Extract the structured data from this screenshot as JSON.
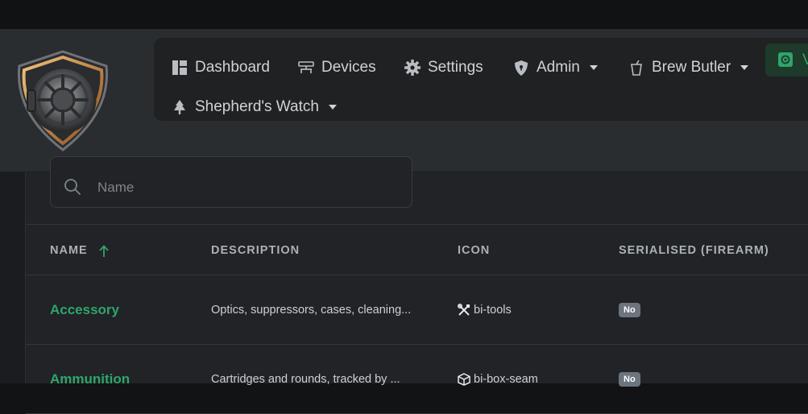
{
  "nav": {
    "items": [
      {
        "label": "Dashboard",
        "icon": "dashboard-icon"
      },
      {
        "label": "Devices",
        "icon": "devices-icon"
      },
      {
        "label": "Settings",
        "icon": "gear-icon"
      },
      {
        "label": "Admin",
        "icon": "shield-icon",
        "dropdown": true
      },
      {
        "label": "Brew Butler",
        "icon": "cup-icon",
        "dropdown": true
      },
      {
        "label": "Shepherd's Watch",
        "icon": "tree-icon",
        "dropdown": true
      }
    ],
    "active_label": "V",
    "active_color": "#1d3a2a",
    "accent_color": "#2fa56a"
  },
  "search": {
    "placeholder": "Name"
  },
  "table": {
    "columns": [
      "NAME",
      "DESCRIPTION",
      "ICON",
      "SERIALISED (FIREARM)"
    ],
    "rows": [
      {
        "name": "Accessory",
        "description": "Optics, suppressors, cases, cleaning...",
        "icon_name": "bi-tools",
        "serialised": "No"
      },
      {
        "name": "Ammunition",
        "description": "Cartridges and rounds, tracked by ...",
        "icon_name": "bi-box-seam",
        "serialised": "No"
      }
    ]
  }
}
